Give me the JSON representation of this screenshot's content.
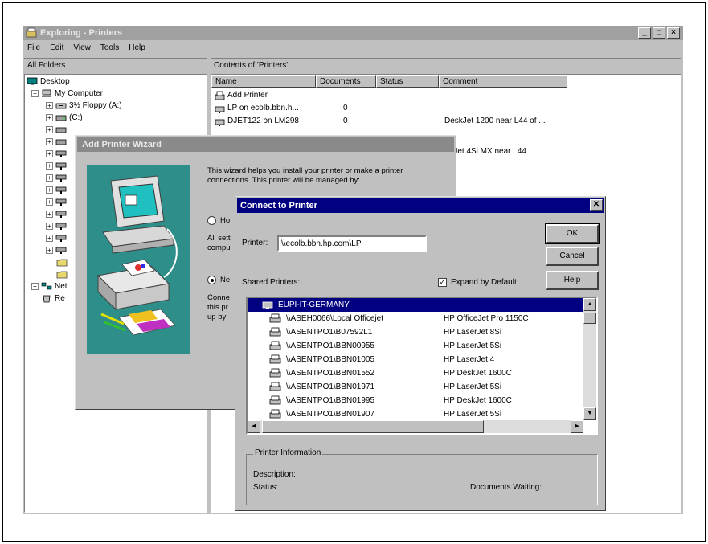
{
  "explorer": {
    "title": "Exploring - Printers",
    "menu": [
      "File",
      "Edit",
      "View",
      "Tools",
      "Help"
    ],
    "left_header": "All Folders",
    "right_header": "Contents of 'Printers'",
    "tree": {
      "desktop": "Desktop",
      "my_computer": "My Computer",
      "floppy": "3½ Floppy (A:)",
      "c_drive": "(C:)",
      "network": "Net",
      "recycle": "Re"
    },
    "columns": [
      "Name",
      "Documents",
      "Status",
      "Comment"
    ],
    "printers": [
      {
        "name": "Add Printer",
        "docs": "",
        "comment": ""
      },
      {
        "name": "LP on ecolb.bbn.h...",
        "docs": "0",
        "comment": ""
      },
      {
        "name": "DJET122 on LM298",
        "docs": "0",
        "comment": "DeskJet 1200 near L44 of ..."
      },
      {
        "name": "",
        "docs": "",
        "comment": "rJet 4Si MX near L44"
      }
    ]
  },
  "wizard": {
    "title": "Add Printer Wizard",
    "intro": [
      "This wizard helps you install your printer or make a printer",
      "connections.  This printer will be managed by:"
    ],
    "option1": "Ho",
    "option1_desc": [
      "All sett",
      "compu"
    ],
    "option2": "Ne",
    "option2_desc": [
      "Conne",
      "this pr",
      "up by"
    ]
  },
  "connect": {
    "title": "Connect to Printer",
    "close": "✕",
    "printer_label": "Printer:",
    "printer_value": "\\\\ecolb.bbn.hp.com\\LP",
    "ok_label": "OK",
    "cancel_label": "Cancel",
    "help_label": "Help",
    "shared_label": "Shared Printers:",
    "expand_label": "Expand by Default",
    "expand_checked": "✓",
    "list": [
      {
        "name": "EUPI-IT-GERMANY",
        "model": "",
        "selected": true,
        "kind": "domain"
      },
      {
        "name": "\\\\ASEH0066\\Local Officejet",
        "model": "HP OfficeJet Pro 1150C"
      },
      {
        "name": "\\\\ASENTPO1\\B07592L1",
        "model": "HP LaserJet 8Si"
      },
      {
        "name": "\\\\ASENTPO1\\BBN00955",
        "model": "HP LaserJet 5Si"
      },
      {
        "name": "\\\\ASENTPO1\\BBN01005",
        "model": "HP LaserJet 4"
      },
      {
        "name": "\\\\ASENTPO1\\BBN01552",
        "model": "HP DeskJet 1600C"
      },
      {
        "name": "\\\\ASENTPO1\\BBN01971",
        "model": "HP LaserJet 5Si"
      },
      {
        "name": "\\\\ASENTPO1\\BBN01995",
        "model": "HP DeskJet 1600C"
      },
      {
        "name": "\\\\ASENTPO1\\BBN01907",
        "model": "HP LaserJet 5Si"
      }
    ],
    "info_title": "Printer Information",
    "description_label": "Description:",
    "status_label": "Status:",
    "docs_waiting_label": "Documents Waiting:"
  }
}
